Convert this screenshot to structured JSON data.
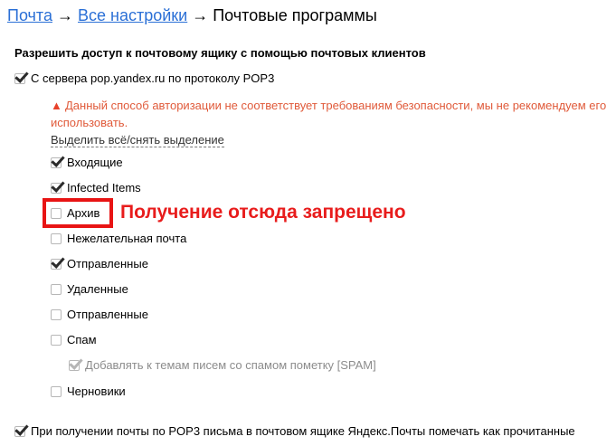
{
  "breadcrumb": {
    "link1": "Почта",
    "sep1": " → ",
    "link2": "Все настройки",
    "sep2": " → ",
    "current": "Почтовые программы"
  },
  "section_title": "Разрешить доступ к почтовому ящику с помощью почтовых клиентов",
  "pop3_option": {
    "label": "С сервера pop.yandex.ru по протоколу POP3",
    "checked": true
  },
  "warning": {
    "icon": "warning-icon",
    "text": "Данный способ авторизации не соответствует требованиям безопасности, мы не рекомендуем его использовать."
  },
  "select_all_label": "Выделить всё/снять выделение",
  "folders": [
    {
      "label": "Входящие",
      "checked": true
    },
    {
      "label": "Infected Items",
      "checked": true
    },
    {
      "label": "Архив",
      "checked": false
    },
    {
      "label": "Нежелательная почта",
      "checked": false
    },
    {
      "label": "Отправленные",
      "checked": true
    },
    {
      "label": "Удаленные",
      "checked": false
    },
    {
      "label": "Отправленные",
      "checked": false
    },
    {
      "label": "Спам",
      "checked": false
    },
    {
      "label": "Черновики",
      "checked": false
    }
  ],
  "spam_tag_option": {
    "label": "Добавлять к темам писем со спамом пометку [SPAM]",
    "checked": true,
    "disabled": true
  },
  "mark_read_option": {
    "label": "При получении почты по POP3 письма в почтовом ящике Яндекс.Почты помечать как прочитанные",
    "checked": true
  },
  "annotation": {
    "text": "Получение отсюда запрещено",
    "color": "#e81c1c"
  }
}
